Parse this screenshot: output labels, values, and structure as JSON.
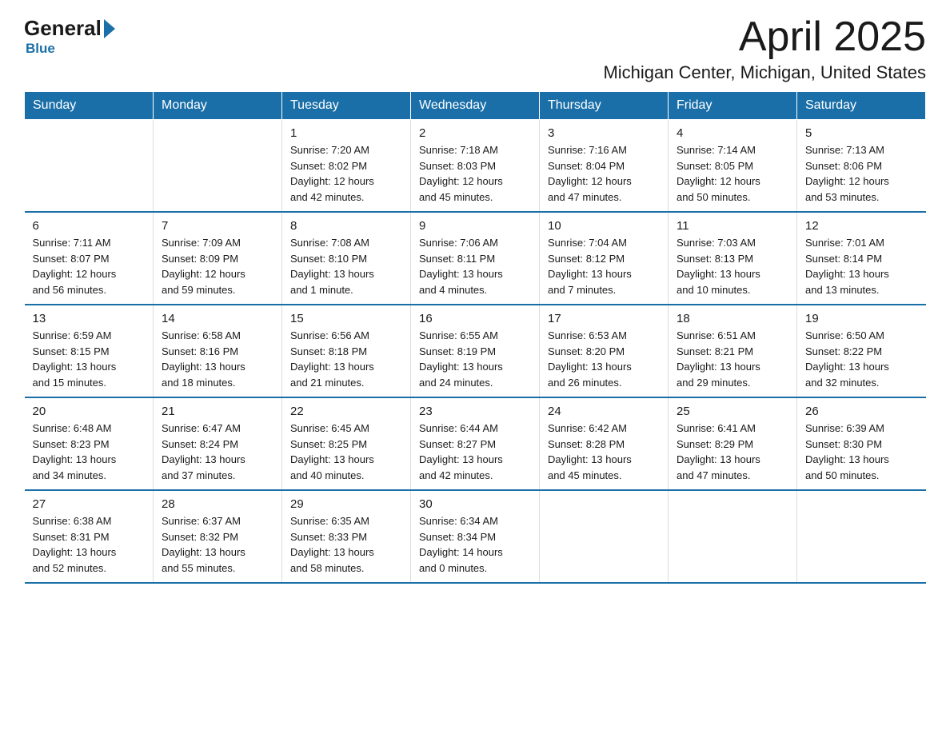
{
  "logo": {
    "general": "General",
    "blue": "Blue",
    "subtitle": "Blue"
  },
  "header": {
    "month_title": "April 2025",
    "location": "Michigan Center, Michigan, United States"
  },
  "calendar": {
    "days_of_week": [
      "Sunday",
      "Monday",
      "Tuesday",
      "Wednesday",
      "Thursday",
      "Friday",
      "Saturday"
    ],
    "weeks": [
      [
        {
          "day": "",
          "info": ""
        },
        {
          "day": "",
          "info": ""
        },
        {
          "day": "1",
          "info": "Sunrise: 7:20 AM\nSunset: 8:02 PM\nDaylight: 12 hours\nand 42 minutes."
        },
        {
          "day": "2",
          "info": "Sunrise: 7:18 AM\nSunset: 8:03 PM\nDaylight: 12 hours\nand 45 minutes."
        },
        {
          "day": "3",
          "info": "Sunrise: 7:16 AM\nSunset: 8:04 PM\nDaylight: 12 hours\nand 47 minutes."
        },
        {
          "day": "4",
          "info": "Sunrise: 7:14 AM\nSunset: 8:05 PM\nDaylight: 12 hours\nand 50 minutes."
        },
        {
          "day": "5",
          "info": "Sunrise: 7:13 AM\nSunset: 8:06 PM\nDaylight: 12 hours\nand 53 minutes."
        }
      ],
      [
        {
          "day": "6",
          "info": "Sunrise: 7:11 AM\nSunset: 8:07 PM\nDaylight: 12 hours\nand 56 minutes."
        },
        {
          "day": "7",
          "info": "Sunrise: 7:09 AM\nSunset: 8:09 PM\nDaylight: 12 hours\nand 59 minutes."
        },
        {
          "day": "8",
          "info": "Sunrise: 7:08 AM\nSunset: 8:10 PM\nDaylight: 13 hours\nand 1 minute."
        },
        {
          "day": "9",
          "info": "Sunrise: 7:06 AM\nSunset: 8:11 PM\nDaylight: 13 hours\nand 4 minutes."
        },
        {
          "day": "10",
          "info": "Sunrise: 7:04 AM\nSunset: 8:12 PM\nDaylight: 13 hours\nand 7 minutes."
        },
        {
          "day": "11",
          "info": "Sunrise: 7:03 AM\nSunset: 8:13 PM\nDaylight: 13 hours\nand 10 minutes."
        },
        {
          "day": "12",
          "info": "Sunrise: 7:01 AM\nSunset: 8:14 PM\nDaylight: 13 hours\nand 13 minutes."
        }
      ],
      [
        {
          "day": "13",
          "info": "Sunrise: 6:59 AM\nSunset: 8:15 PM\nDaylight: 13 hours\nand 15 minutes."
        },
        {
          "day": "14",
          "info": "Sunrise: 6:58 AM\nSunset: 8:16 PM\nDaylight: 13 hours\nand 18 minutes."
        },
        {
          "day": "15",
          "info": "Sunrise: 6:56 AM\nSunset: 8:18 PM\nDaylight: 13 hours\nand 21 minutes."
        },
        {
          "day": "16",
          "info": "Sunrise: 6:55 AM\nSunset: 8:19 PM\nDaylight: 13 hours\nand 24 minutes."
        },
        {
          "day": "17",
          "info": "Sunrise: 6:53 AM\nSunset: 8:20 PM\nDaylight: 13 hours\nand 26 minutes."
        },
        {
          "day": "18",
          "info": "Sunrise: 6:51 AM\nSunset: 8:21 PM\nDaylight: 13 hours\nand 29 minutes."
        },
        {
          "day": "19",
          "info": "Sunrise: 6:50 AM\nSunset: 8:22 PM\nDaylight: 13 hours\nand 32 minutes."
        }
      ],
      [
        {
          "day": "20",
          "info": "Sunrise: 6:48 AM\nSunset: 8:23 PM\nDaylight: 13 hours\nand 34 minutes."
        },
        {
          "day": "21",
          "info": "Sunrise: 6:47 AM\nSunset: 8:24 PM\nDaylight: 13 hours\nand 37 minutes."
        },
        {
          "day": "22",
          "info": "Sunrise: 6:45 AM\nSunset: 8:25 PM\nDaylight: 13 hours\nand 40 minutes."
        },
        {
          "day": "23",
          "info": "Sunrise: 6:44 AM\nSunset: 8:27 PM\nDaylight: 13 hours\nand 42 minutes."
        },
        {
          "day": "24",
          "info": "Sunrise: 6:42 AM\nSunset: 8:28 PM\nDaylight: 13 hours\nand 45 minutes."
        },
        {
          "day": "25",
          "info": "Sunrise: 6:41 AM\nSunset: 8:29 PM\nDaylight: 13 hours\nand 47 minutes."
        },
        {
          "day": "26",
          "info": "Sunrise: 6:39 AM\nSunset: 8:30 PM\nDaylight: 13 hours\nand 50 minutes."
        }
      ],
      [
        {
          "day": "27",
          "info": "Sunrise: 6:38 AM\nSunset: 8:31 PM\nDaylight: 13 hours\nand 52 minutes."
        },
        {
          "day": "28",
          "info": "Sunrise: 6:37 AM\nSunset: 8:32 PM\nDaylight: 13 hours\nand 55 minutes."
        },
        {
          "day": "29",
          "info": "Sunrise: 6:35 AM\nSunset: 8:33 PM\nDaylight: 13 hours\nand 58 minutes."
        },
        {
          "day": "30",
          "info": "Sunrise: 6:34 AM\nSunset: 8:34 PM\nDaylight: 14 hours\nand 0 minutes."
        },
        {
          "day": "",
          "info": ""
        },
        {
          "day": "",
          "info": ""
        },
        {
          "day": "",
          "info": ""
        }
      ]
    ]
  }
}
